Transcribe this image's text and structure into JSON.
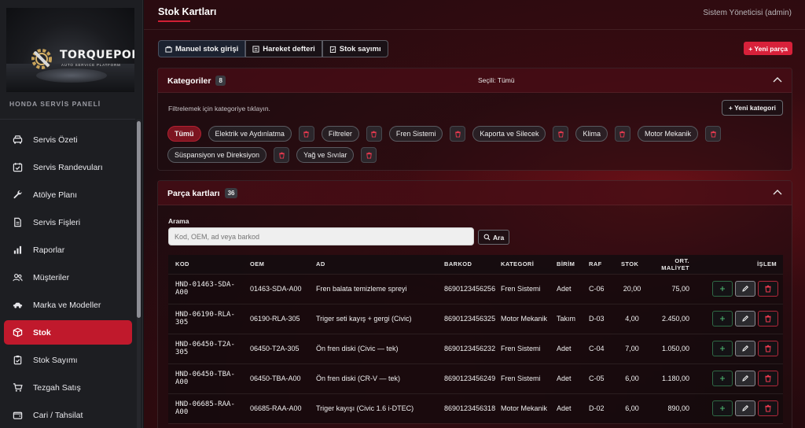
{
  "brand": {
    "title": "TORQUEPORT",
    "subtitle": "AUTO SERVICE PLATFORM"
  },
  "sidebar": {
    "panel_title": "HONDA SERVİS PANELİ",
    "items": [
      {
        "label": "Servis Özeti",
        "icon": "car-front-icon"
      },
      {
        "label": "Servis Randevuları",
        "icon": "calendar-check-icon"
      },
      {
        "label": "Atölye Planı",
        "icon": "wrench-icon"
      },
      {
        "label": "Servis Fişleri",
        "icon": "document-icon"
      },
      {
        "label": "Raporlar",
        "icon": "bar-chart-icon"
      },
      {
        "label": "Müşteriler",
        "icon": "users-icon"
      },
      {
        "label": "Marka ve Modeller",
        "icon": "car-side-icon"
      },
      {
        "label": "Stok",
        "icon": "box-icon"
      },
      {
        "label": "Stok Sayımı",
        "icon": "clipboard-check-icon"
      },
      {
        "label": "Tezgah Satış",
        "icon": "cart-icon"
      },
      {
        "label": "Cari / Tahsilat",
        "icon": "wallet-icon"
      }
    ],
    "active_color": "#c0192c"
  },
  "header": {
    "title": "Stok Kartları",
    "user": "Sistem Yöneticisi (admin)"
  },
  "toolbar": {
    "manual_entry": "Manuel stok girişi",
    "ledger": "Hareket defteri",
    "count": "Stok sayımı",
    "new_part": "+ Yeni parça"
  },
  "categories": {
    "title": "Kategoriler",
    "count": "8",
    "selected": "Seçili: Tümü",
    "hint": "Filtrelemek için kategoriye tıklayın.",
    "new_button": "+ Yeni kategori",
    "row1": [
      "Tümü",
      "Elektrik ve Aydınlatma",
      "Filtreler",
      "Fren Sistemi",
      "Kaporta ve Silecek",
      "Klima",
      "Motor Mekanik"
    ],
    "row2": [
      "Süspansiyon ve Direksiyon",
      "Yağ ve Sıvılar"
    ]
  },
  "parts": {
    "title": "Parça kartları",
    "count": "36",
    "search_label": "Arama",
    "search_placeholder": "Kod, OEM, ad veya barkod",
    "search_button": "Ara",
    "columns": [
      "KOD",
      "OEM",
      "AD",
      "BARKOD",
      "KATEGORİ",
      "BİRİM",
      "RAF",
      "STOK",
      "ORT. MALİYET",
      "İŞLEM"
    ],
    "rows": [
      {
        "kod": "HND-01463-SDA-A00",
        "oem": "01463-SDA-A00",
        "ad": "Fren balata temizleme spreyi",
        "barkod": "8690123456256",
        "kategori": "Fren Sistemi",
        "birim": "Adet",
        "raf": "C-06",
        "stok": "20,00",
        "maliyet": "75,00"
      },
      {
        "kod": "HND-06190-RLA-305",
        "oem": "06190-RLA-305",
        "ad": "Triger seti kayış + gergi (Civic)",
        "barkod": "8690123456325",
        "kategori": "Motor Mekanik",
        "birim": "Takım",
        "raf": "D-03",
        "stok": "4,00",
        "maliyet": "2.450,00"
      },
      {
        "kod": "HND-06450-T2A-305",
        "oem": "06450-T2A-305",
        "ad": "Ön fren diski (Civic — tek)",
        "barkod": "8690123456232",
        "kategori": "Fren Sistemi",
        "birim": "Adet",
        "raf": "C-04",
        "stok": "7,00",
        "maliyet": "1.050,00"
      },
      {
        "kod": "HND-06450-TBA-A00",
        "oem": "06450-TBA-A00",
        "ad": "Ön fren diski (CR-V — tek)",
        "barkod": "8690123456249",
        "kategori": "Fren Sistemi",
        "birim": "Adet",
        "raf": "C-05",
        "stok": "6,00",
        "maliyet": "1.180,00"
      },
      {
        "kod": "HND-06685-RAA-A00",
        "oem": "06685-RAA-A00",
        "ad": "Triger kayışı (Civic 1.6 i-DTEC)",
        "barkod": "8690123456318",
        "kategori": "Motor Mekanik",
        "birim": "Adet",
        "raf": "D-02",
        "stok": "6,00",
        "maliyet": "890,00"
      }
    ]
  }
}
